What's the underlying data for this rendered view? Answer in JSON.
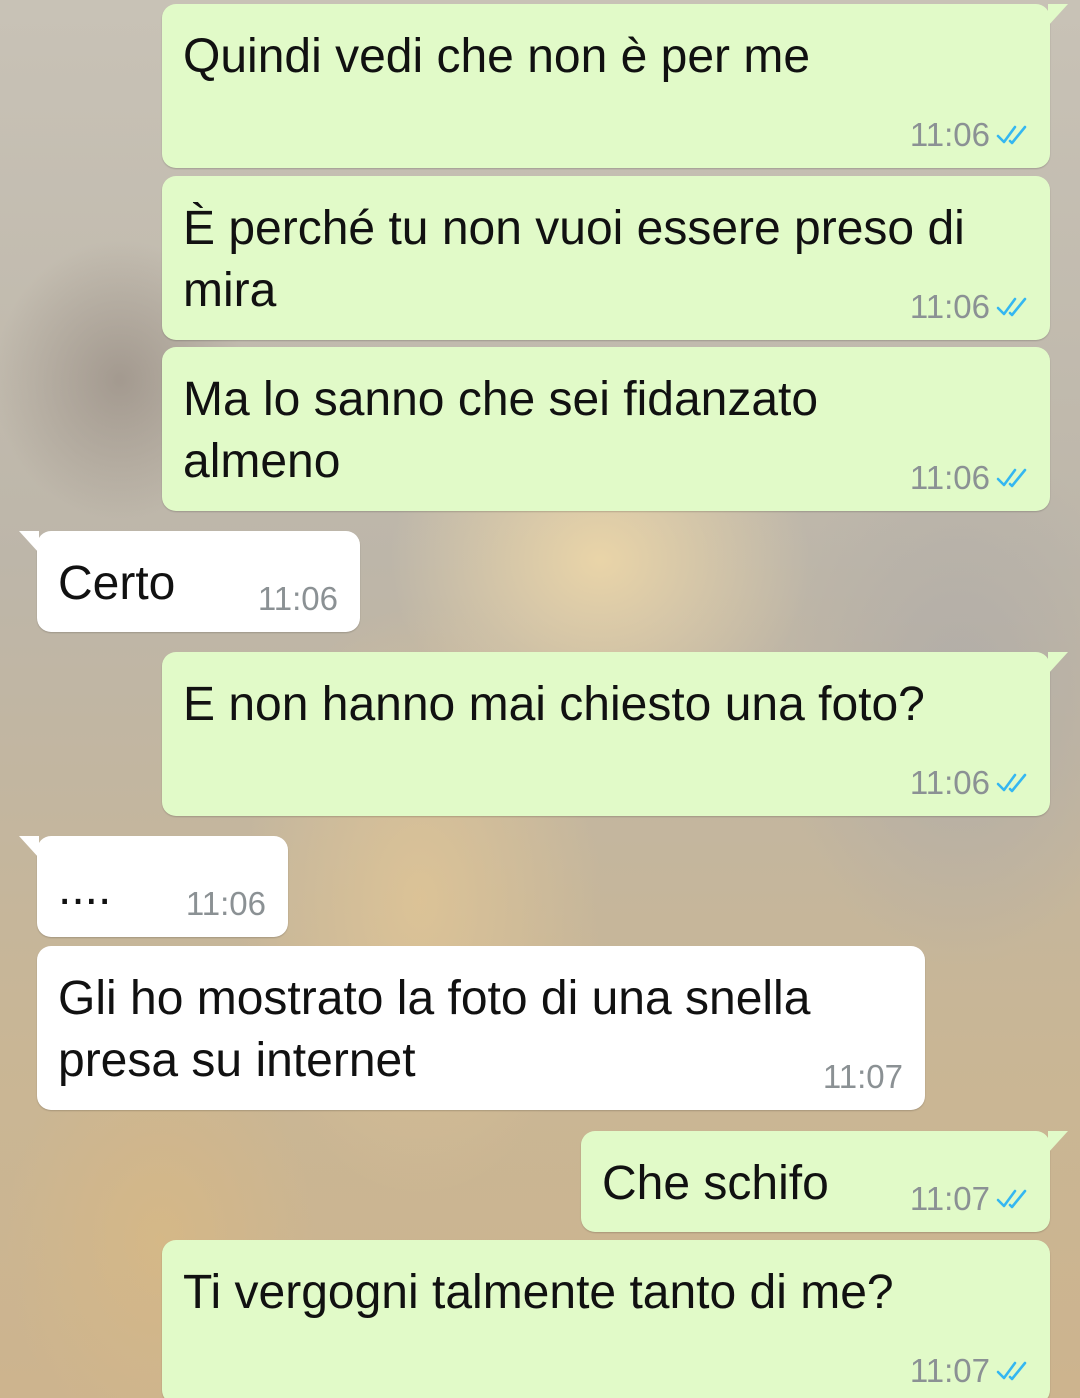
{
  "messages": [
    {
      "direction": "outgoing",
      "text": "Quindi vedi che non è per me",
      "time": "11:06",
      "status_icon": "double-check-read-icon",
      "status_color": "#34b7f1"
    },
    {
      "direction": "outgoing",
      "text": "È perché tu non vuoi essere preso di\nmira",
      "time": "11:06",
      "status_icon": "double-check-read-icon",
      "status_color": "#34b7f1"
    },
    {
      "direction": "outgoing",
      "text": "Ma lo sanno che sei fidanzato\nalmeno",
      "time": "11:06",
      "status_icon": "double-check-read-icon",
      "status_color": "#34b7f1"
    },
    {
      "direction": "incoming",
      "text": "Certo",
      "time": "11:06"
    },
    {
      "direction": "outgoing",
      "text": "E non hanno mai chiesto una foto?",
      "time": "11:06",
      "status_icon": "double-check-read-icon",
      "status_color": "#34b7f1"
    },
    {
      "direction": "incoming",
      "text": "....",
      "time": "11:06"
    },
    {
      "direction": "incoming",
      "text": "Gli ho mostrato la foto di una snella\npresa su internet",
      "time": "11:07"
    },
    {
      "direction": "outgoing",
      "text": "Che schifo",
      "time": "11:07",
      "status_icon": "double-check-read-icon",
      "status_color": "#34b7f1"
    },
    {
      "direction": "outgoing",
      "text": "Ti vergogni talmente tanto di me?",
      "time": "11:07",
      "status_icon": "double-check-read-icon",
      "status_color": "#34b7f1"
    }
  ],
  "colors": {
    "outgoing_bubble": "#e1fac8",
    "incoming_bubble": "#ffffff",
    "timestamp": "#8b9194",
    "read_ticks": "#34b7f1"
  }
}
